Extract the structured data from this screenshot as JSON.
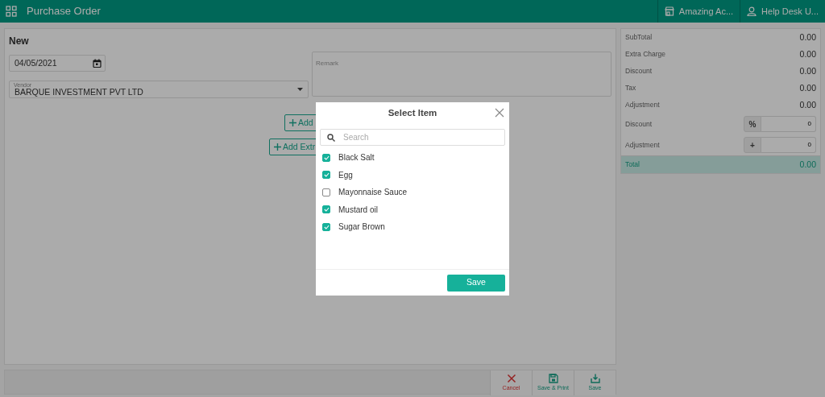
{
  "topbar": {
    "title": "Purchase Order",
    "company": "Amazing Ac...",
    "user": "Help Desk U..."
  },
  "form": {
    "heading": "New",
    "date": "04/05/2021",
    "vendor": {
      "label": "Vendor",
      "value": "BARQUE INVESTMENT PVT LTD"
    },
    "remark": {
      "placeholder": "Remark"
    },
    "buttons": [
      "Add",
      "Add Extr"
    ]
  },
  "summary": {
    "rows": [
      {
        "label": "SubTotal",
        "value": "0.00"
      },
      {
        "label": "Extra Charge",
        "value": "0.00"
      },
      {
        "label": "Discount",
        "value": "0.00"
      },
      {
        "label": "Tax",
        "value": "0.00"
      },
      {
        "label": "Adjustment",
        "value": "0.00"
      }
    ],
    "inputs": [
      {
        "label": "Discount",
        "prefix": "%",
        "value": "0"
      },
      {
        "label": "Adjustment",
        "prefix": "+",
        "value": "0"
      }
    ],
    "total": {
      "label": "Total",
      "value": "0.00"
    }
  },
  "actions": [
    {
      "kind": "cancel",
      "label": "Cancel"
    },
    {
      "kind": "save_print",
      "label": "Save & Print"
    },
    {
      "kind": "save",
      "label": "Save"
    }
  ],
  "modal": {
    "title": "Select Item",
    "search": {
      "placeholder": "Search"
    },
    "items": [
      {
        "label": "Black Salt",
        "checked": true
      },
      {
        "label": "Egg",
        "checked": true
      },
      {
        "label": "Mayonnaise Sauce",
        "checked": false
      },
      {
        "label": "Mustard oil",
        "checked": true
      },
      {
        "label": "Sugar Brown",
        "checked": true
      }
    ],
    "save": "Save"
  }
}
